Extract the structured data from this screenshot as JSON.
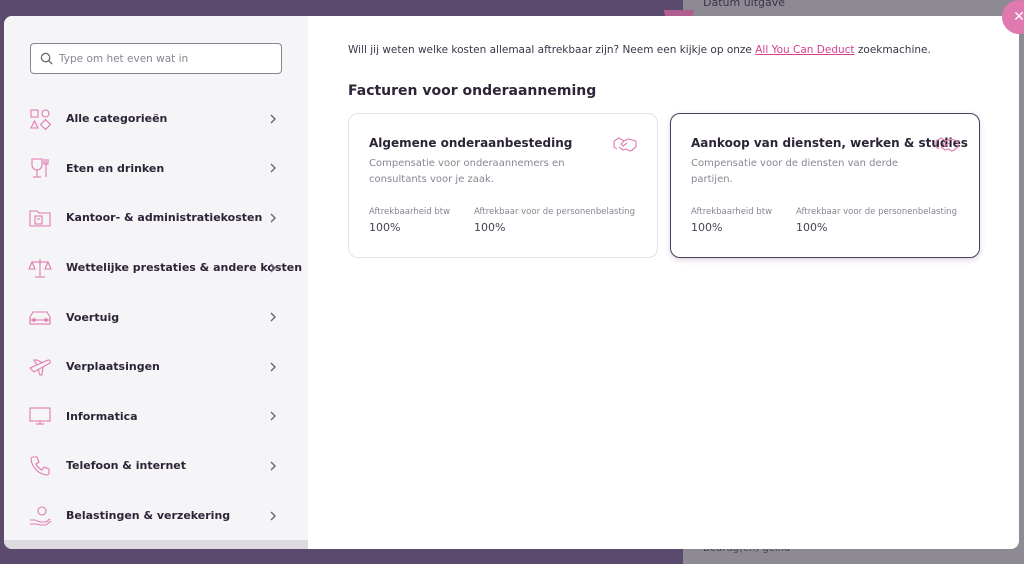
{
  "background": {
    "datum_label": "Datum uitgave",
    "bottom_text": "Bedrag(en) geïnd"
  },
  "search": {
    "placeholder": "Type om het even wat in"
  },
  "categories": [
    {
      "label": "Alle categorieën",
      "icon": "shapes-icon"
    },
    {
      "label": "Eten en drinken",
      "icon": "food-drink-icon"
    },
    {
      "label": "Kantoor- & administratiekosten",
      "icon": "folder-icon"
    },
    {
      "label": "Wettelijke prestaties & andere kosten",
      "icon": "scales-icon"
    },
    {
      "label": "Voertuig",
      "icon": "car-icon"
    },
    {
      "label": "Verplaatsingen",
      "icon": "airplane-icon"
    },
    {
      "label": "Informatica",
      "icon": "monitor-icon"
    },
    {
      "label": "Telefoon & internet",
      "icon": "phone-icon"
    },
    {
      "label": "Belastingen & verzekering",
      "icon": "hand-coin-icon"
    }
  ],
  "intro": {
    "text_before": "Will jij weten welke kosten allemaal aftrekbaar zijn? Neem een kijkje op onze ",
    "link": "All You Can Deduct",
    "text_after": " zoekmachine."
  },
  "section_title": "Facturen voor onderaanneming",
  "cards": [
    {
      "title": "Algemene onderaanbesteding",
      "description": "Compensatie voor onderaannemers en consultants voor je zaak.",
      "vat_label": "Aftrekbaarheid btw",
      "vat_value": "100%",
      "tax_label": "Aftrekbaar voor de personenbelasting",
      "tax_value": "100%",
      "icon": "handshake-icon",
      "selected": false
    },
    {
      "title": "Aankoop van diensten, werken & studies",
      "description": "Compensatie voor de diensten van derde partijen.",
      "vat_label": "Aftrekbaarheid btw",
      "vat_value": "100%",
      "tax_label": "Aftrekbaar voor de personenbelasting",
      "tax_value": "100%",
      "icon": "handshake-icon",
      "selected": true
    }
  ],
  "colors": {
    "accent": "#d5408e",
    "text_dark": "#2d2438",
    "text_muted": "#8a8490",
    "selected_border": "#4e3d63"
  }
}
